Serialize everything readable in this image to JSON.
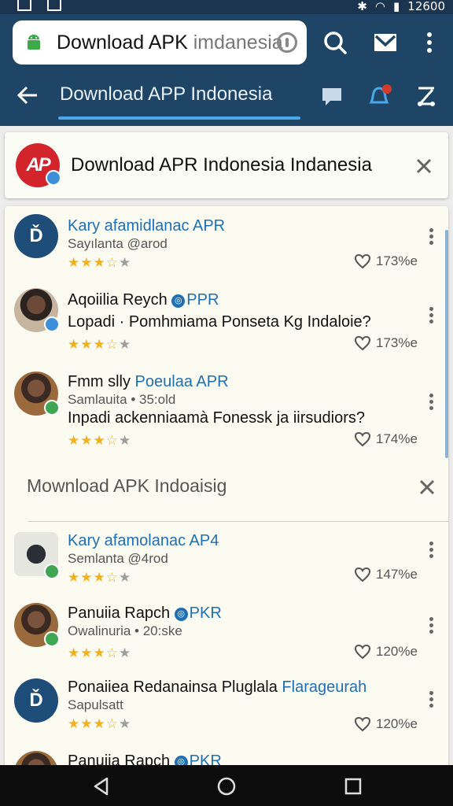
{
  "status_bar": {
    "time": "12600"
  },
  "browser": {
    "url_main": "Download APK ",
    "url_faded": "imdanesia",
    "icons": [
      "android-icon",
      "info-icon",
      "search-icon",
      "mail-icon",
      "more-vert-icon"
    ]
  },
  "nav": {
    "title": "Download APP Indonesia",
    "icons": [
      "back-arrow-icon",
      "chat-icon",
      "bell-icon",
      "share-icon"
    ]
  },
  "banner": {
    "logo_text": "AP",
    "title": "Download APR Indonesia Indanesia"
  },
  "items_top": [
    {
      "title": "Kary afamidlanac APR",
      "title_verified": "",
      "subtitle": "Sayılanta  @arod",
      "question": "",
      "rating": 3.5,
      "likes": "173%e",
      "avatar": "logo",
      "avatar_text": "Ď"
    },
    {
      "title": "Aqoiilia Reych ",
      "title_verified": "PPR",
      "subtitle": "",
      "question": "Lopadi · Pomhmiama Ponseta Kg Indaloie?",
      "rating": 3.5,
      "likes": "173%e",
      "avatar": "person"
    },
    {
      "title": "Fmm slly ",
      "title_blue": "Poeulaa APR",
      "subtitle": "Samlauita • 35:old",
      "question": "Inpadi ackenniaamà Fonessk ja iirsudiors?",
      "rating": 3.5,
      "likes": "174%e",
      "avatar": "person2"
    }
  ],
  "section": {
    "title": "Mownload APK Indoaisig"
  },
  "items_bottom": [
    {
      "title": "Kary afamolanac AP4",
      "subtitle": "Semlanta @4rod",
      "rating": 3.5,
      "likes": "147%e",
      "avatar": "phone"
    },
    {
      "title": "Panuiia Rapch ",
      "title_verified": "PKR",
      "subtitle": "Owalinuria  • 20:ske",
      "rating": 3.5,
      "likes": "120%e",
      "avatar": "person2"
    },
    {
      "title": "Ponaiiea Redanainsa Pluglala ",
      "title_blue": "Flarageurah",
      "subtitle": "Sapulsatt",
      "rating": 3.5,
      "likes": "120%e",
      "avatar": "logo",
      "avatar_text": "Ď"
    },
    {
      "title": "Panuiia Rapch ",
      "title_verified": "PKR"
    }
  ],
  "colors": {
    "toolbar": "#1e4566",
    "accent": "#4aa7ea",
    "link_blue": "#1f6fb5",
    "star": "#f2b01e",
    "brand_red": "#d3232b"
  }
}
